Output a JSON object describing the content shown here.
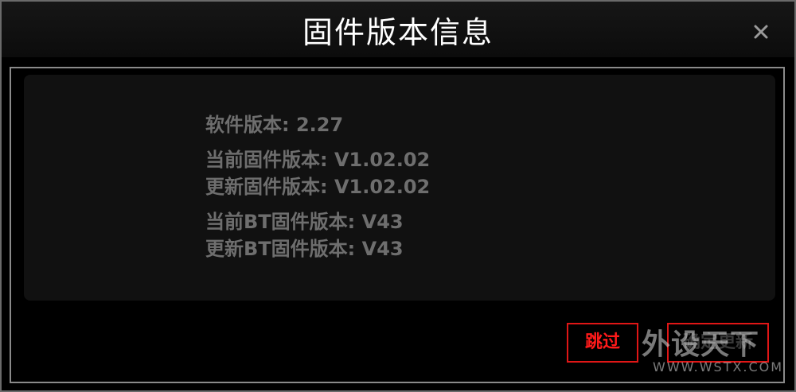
{
  "window": {
    "title": "固件版本信息"
  },
  "info": {
    "software_version": "软件版本: 2.27",
    "current_firmware": "当前固件版本: V1.02.02",
    "update_firmware": "更新固件版本: V1.02.02",
    "current_bt_firmware": "当前BT固件版本: V43",
    "update_bt_firmware": "更新BT固件版本: V43"
  },
  "buttons": {
    "skip_label": "跳过",
    "update_label": "确定更新"
  },
  "watermark": {
    "text": "外设天下",
    "url": "WWW.WSTX.COM"
  },
  "colors": {
    "accent": "#e01616",
    "info_text": "#6e6e6e",
    "title_text": "#ffffff"
  },
  "icons": {
    "close": "close-icon"
  }
}
